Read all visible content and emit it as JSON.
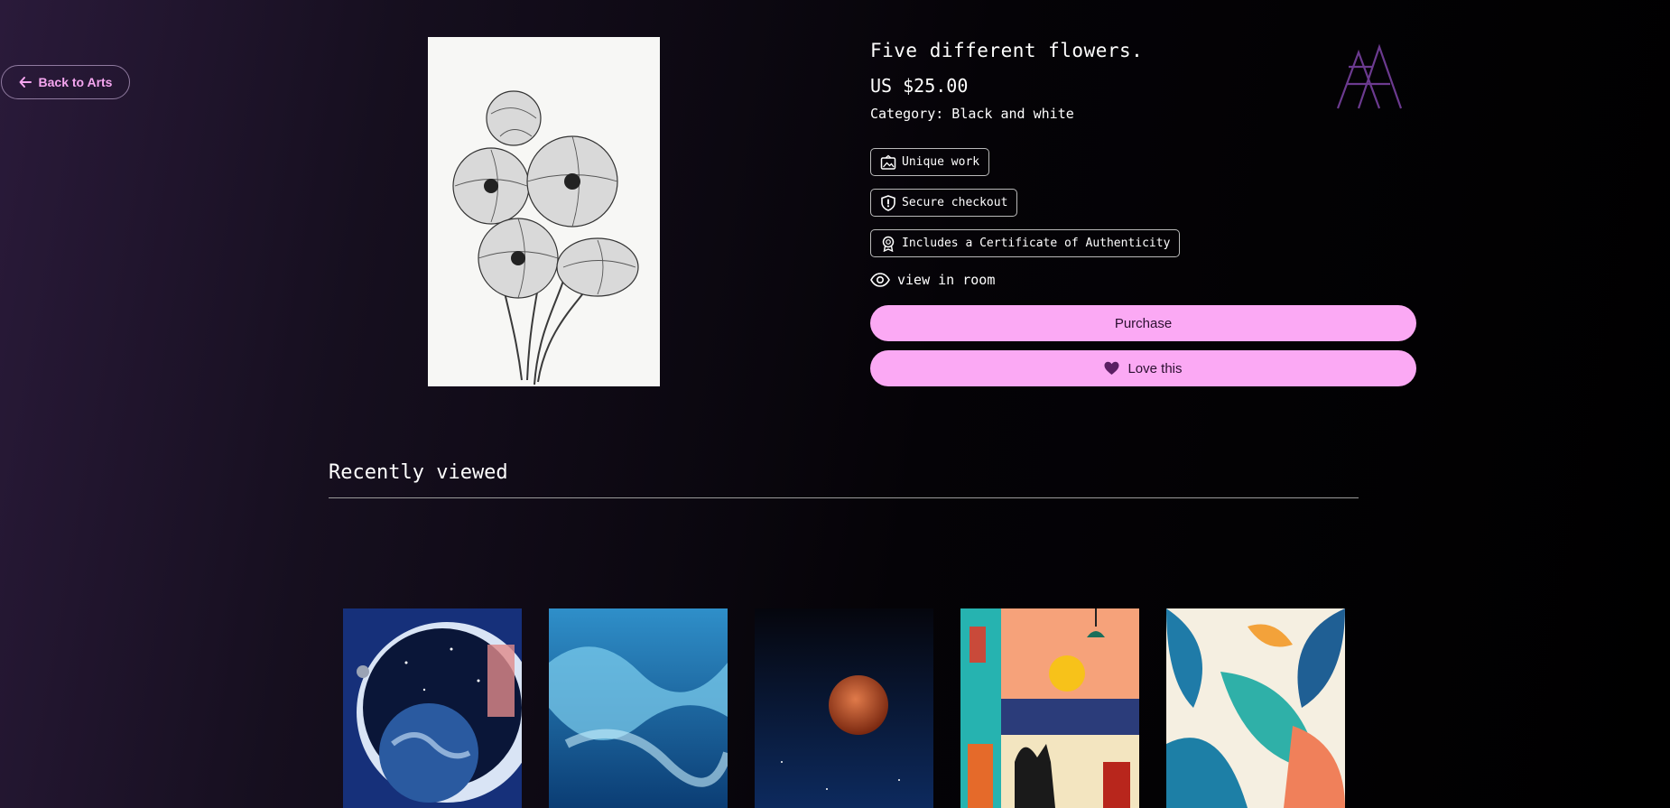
{
  "back": {
    "label": "Back to Arts",
    "icon": "arrow-left-icon"
  },
  "product": {
    "title": "Five different flowers.",
    "price": "US $25.00",
    "category": "Category: Black and white",
    "image_icon": "flowers-drawing"
  },
  "features": [
    {
      "label": "Unique work",
      "icon": "picture-frame-icon"
    },
    {
      "label": "Secure checkout",
      "icon": "shield-icon"
    },
    {
      "label": "Includes a Certificate of Authenticity",
      "icon": "certificate-ribbon-icon"
    }
  ],
  "view_room": {
    "label": "view in room",
    "icon": "eye-icon"
  },
  "actions": {
    "purchase": "Purchase",
    "love": "Love this",
    "love_icon": "heart-icon"
  },
  "recently_viewed": {
    "heading": "Recently viewed",
    "items": [
      {
        "name": "astronaut-earth-artwork"
      },
      {
        "name": "blue-clouds-artwork"
      },
      {
        "name": "red-moon-artwork"
      },
      {
        "name": "cat-window-artwork"
      },
      {
        "name": "tropical-leaves-artwork"
      }
    ]
  },
  "colors": {
    "accent": "#fba9f4",
    "back_text": "#f5a6f0",
    "logo": "#6b3a8f"
  }
}
